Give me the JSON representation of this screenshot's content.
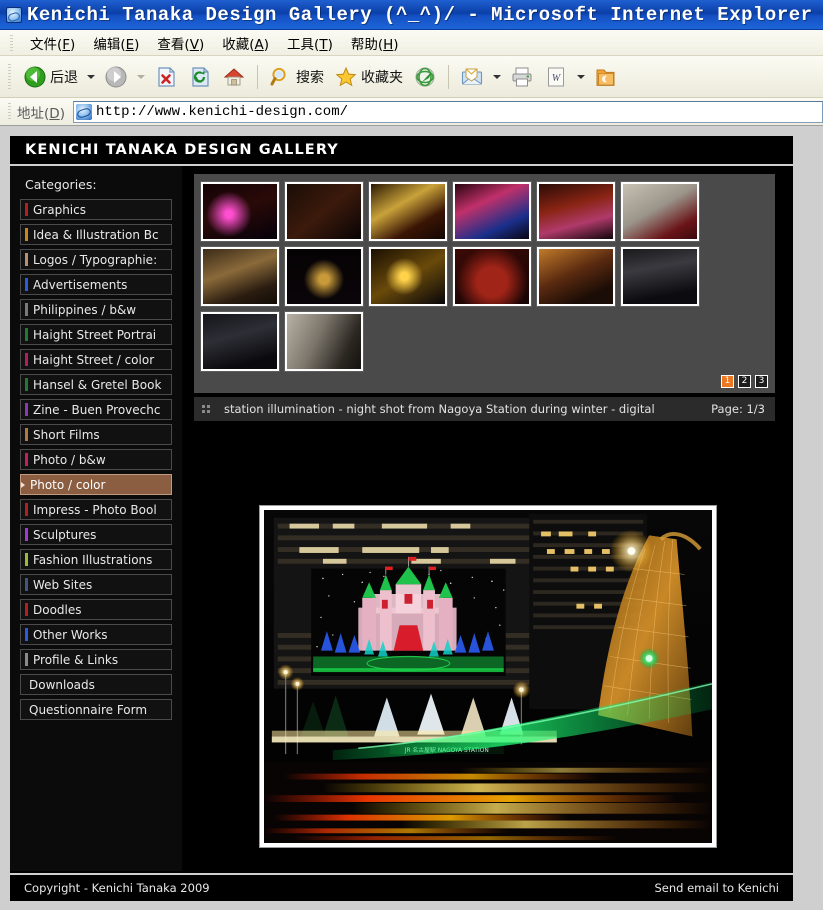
{
  "browser": {
    "window_title": "Kenichi Tanaka Design Gallery (^_^)/ - Microsoft Internet Explorer",
    "logo_icon": "ie-logo-icon",
    "menus": [
      {
        "label": "文件",
        "accel": "F"
      },
      {
        "label": "编辑",
        "accel": "E"
      },
      {
        "label": "查看",
        "accel": "V"
      },
      {
        "label": "收藏",
        "accel": "A"
      },
      {
        "label": "工具",
        "accel": "T"
      },
      {
        "label": "帮助",
        "accel": "H"
      }
    ],
    "toolbar": {
      "back_label": "后退",
      "back_icon": "back-arrow-icon",
      "forward_icon": "forward-arrow-icon",
      "stop_icon": "stop-icon",
      "refresh_icon": "refresh-icon",
      "home_icon": "home-icon",
      "search_label": "搜索",
      "search_icon": "search-icon",
      "favorites_label": "收藏夹",
      "favorites_icon": "star-icon",
      "media_icon": "media-icon",
      "mail_icon": "mail-icon",
      "print_icon": "printer-icon",
      "edit_word_icon": "word-icon",
      "messenger_icon": "folder-icon"
    },
    "address": {
      "label": "地址",
      "accel": "D",
      "url": "http://www.kenichi-design.com/",
      "icon": "ie-page-icon"
    }
  },
  "site": {
    "header_title": "KENICHI TANAKA DESIGN GALLERY",
    "sidebar": {
      "heading": "Categories:",
      "items": [
        {
          "label": "Graphics",
          "color": "#b02020",
          "selected": false
        },
        {
          "label": "Idea & Illustration Bc",
          "color": "#c8861a",
          "selected": false
        },
        {
          "label": "Logos / Typographie:",
          "color": "#b89070",
          "selected": false
        },
        {
          "label": "Advertisements",
          "color": "#2a5ce0",
          "selected": false
        },
        {
          "label": "Philippines / b&w",
          "color": "#7a7a7a",
          "selected": false
        },
        {
          "label": "Haight Street Portrai",
          "color": "#1f7a33",
          "selected": false
        },
        {
          "label": "Haight Street / color",
          "color": "#b02060",
          "selected": false
        },
        {
          "label": "Hansel & Gretel Book",
          "color": "#1f7a33",
          "selected": false
        },
        {
          "label": "Zine - Buen Provechc",
          "color": "#8a3ab0",
          "selected": false
        },
        {
          "label": "Short Films",
          "color": "#b07a3a",
          "selected": false
        },
        {
          "label": "Photo / b&w",
          "color": "#c02060",
          "selected": false
        },
        {
          "label": "Photo / color",
          "color": "#8b5e42",
          "selected": true
        },
        {
          "label": "Impress - Photo Bool",
          "color": "#b02020",
          "selected": false
        },
        {
          "label": "Sculptures",
          "color": "#a03ad0",
          "selected": false
        },
        {
          "label": "Fashion Illustrations",
          "color": "#9aba3a",
          "selected": false
        },
        {
          "label": "Web Sites",
          "color": "#43557f",
          "selected": false
        },
        {
          "label": "Doodles",
          "color": "#b02020",
          "selected": false
        },
        {
          "label": "Other Works",
          "color": "#2a5ce0",
          "selected": false
        },
        {
          "label": "Profile & Links",
          "color": "#8a8a8a",
          "selected": false
        },
        {
          "label": "Downloads",
          "color": "",
          "selected": false
        },
        {
          "label": "Questionnaire Form",
          "color": "",
          "selected": false
        }
      ]
    },
    "gallery": {
      "thumb_count": 14,
      "pages": [
        {
          "label": "1",
          "active": true
        },
        {
          "label": "2",
          "active": false
        },
        {
          "label": "3",
          "active": false
        }
      ],
      "caption_icon": "dots-grid-icon",
      "caption": "station illumination - night shot from Nagoya Station during winter - digital",
      "page_indicator": "Page: 1/3"
    },
    "hero": {
      "alt": "Nagoya Station winter illumination at night with light trails"
    },
    "footer": {
      "copyright": "Copyright -  Kenichi Tanaka 2009",
      "email_link": "Send email to Kenichi"
    }
  }
}
